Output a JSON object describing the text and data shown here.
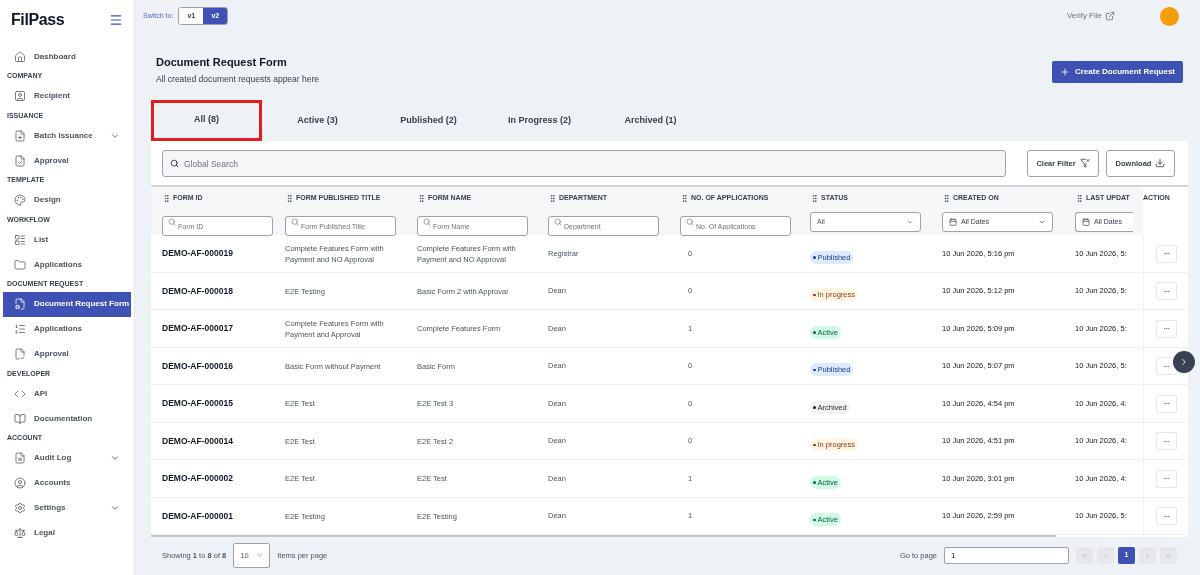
{
  "brand": {
    "logo": "FilPass"
  },
  "sidebar": {
    "sections": [
      {
        "items": [
          {
            "label": "Dashboard",
            "selected": false,
            "has_submenu": false
          }
        ]
      },
      {
        "heading": "COMPANY",
        "items": [
          {
            "label": "Recipient",
            "selected": false,
            "has_submenu": false
          }
        ]
      },
      {
        "heading": "ISSUANCE",
        "items": [
          {
            "label": "Batch Issuance",
            "selected": false,
            "has_submenu": true
          },
          {
            "label": "Approval",
            "selected": false,
            "has_submenu": false
          }
        ]
      },
      {
        "heading": "TEMPLATE",
        "items": [
          {
            "label": "Design",
            "selected": false,
            "has_submenu": false
          }
        ]
      },
      {
        "heading": "WORKFLOW",
        "items": [
          {
            "label": "List",
            "selected": false,
            "has_submenu": false
          },
          {
            "label": "Applications",
            "selected": false,
            "has_submenu": false
          }
        ]
      },
      {
        "heading": "DOCUMENT REQUEST",
        "items": [
          {
            "label": "Document Request Form",
            "selected": true,
            "has_submenu": false
          },
          {
            "label": "Applications",
            "selected": false,
            "has_submenu": false
          },
          {
            "label": "Approval",
            "selected": false,
            "has_submenu": false
          }
        ]
      },
      {
        "heading": "DEVELOPER",
        "items": [
          {
            "label": "API",
            "selected": false,
            "has_submenu": false
          },
          {
            "label": "Documentation",
            "selected": false,
            "has_submenu": false
          }
        ]
      },
      {
        "heading": "ACCOUNT",
        "items": [
          {
            "label": "Audit Log",
            "selected": false,
            "has_submenu": true
          },
          {
            "label": "Accounts",
            "selected": false,
            "has_submenu": false
          },
          {
            "label": "Settings",
            "selected": false,
            "has_submenu": true
          },
          {
            "label": "Legal",
            "selected": false,
            "has_submenu": false
          }
        ]
      }
    ]
  },
  "topbar": {
    "switch_label": "Switch to:",
    "versions": [
      {
        "label": "v1",
        "selected": false
      },
      {
        "label": "v2",
        "selected": true
      }
    ],
    "verify_link": "Verify File"
  },
  "page": {
    "title": "Document Request Form",
    "subtitle": "All created document requests appear here",
    "create_button": "Create Document Request"
  },
  "tabs": [
    {
      "label": "All (8)",
      "selected": true,
      "annotated": true
    },
    {
      "label": "Active (3)",
      "selected": false,
      "annotated": false
    },
    {
      "label": "Published (2)",
      "selected": false,
      "annotated": false
    },
    {
      "label": "In Progress (2)",
      "selected": false,
      "annotated": false
    },
    {
      "label": "Archived (1)",
      "selected": false,
      "annotated": false
    }
  ],
  "toolbar": {
    "search_placeholder": "Global Search",
    "clear_filter": "Clear Filter",
    "download": "Download"
  },
  "table": {
    "columns": [
      {
        "label": "FORM ID",
        "filter": {
          "kind": "search",
          "placeholder": "Form ID"
        }
      },
      {
        "label": "FORM PUBLISHED TITLE",
        "filter": {
          "kind": "search",
          "placeholder": "Form Published Title"
        }
      },
      {
        "label": "FORM NAME",
        "filter": {
          "kind": "search",
          "placeholder": "Form Name"
        }
      },
      {
        "label": "DEPARTMENT",
        "filter": {
          "kind": "search",
          "placeholder": "Department"
        }
      },
      {
        "label": "NO. OF APPLICATIONS",
        "filter": {
          "kind": "search",
          "placeholder": "No. Of Applications"
        }
      },
      {
        "label": "STATUS",
        "filter": {
          "kind": "select",
          "value": "All"
        }
      },
      {
        "label": "CREATED ON",
        "filter": {
          "kind": "date",
          "value": "All Dates"
        }
      },
      {
        "label": "LAST UPDAT",
        "filter": {
          "kind": "date",
          "value": "All Dates"
        }
      },
      {
        "label": "ACTION"
      }
    ],
    "rows": [
      {
        "form_id": "DEMO-AF-000019",
        "published_title": "Complete Features Form with Payment and NO Approval",
        "form_name": "Complete Features Form with Payment and NO Approval",
        "department": "Registrar",
        "applications": "0",
        "status": {
          "label": "Published",
          "kind": "published"
        },
        "created_on": "10 Jun 2026, 5:16 pm",
        "last_updated": "10 Jun 2026, 5:"
      },
      {
        "form_id": "DEMO-AF-000018",
        "published_title": "E2E Testing",
        "form_name": "Basic Form 2 with Approval",
        "department": "Dean",
        "applications": "0",
        "status": {
          "label": "In progress",
          "kind": "in_progress"
        },
        "created_on": "10 Jun 2026, 5:12 pm",
        "last_updated": "10 Jun 2026, 5:"
      },
      {
        "form_id": "DEMO-AF-000017",
        "published_title": "Complete Features Form with Payment and Approval",
        "form_name": "Complete Features Form",
        "department": "Dean",
        "applications": "1",
        "status": {
          "label": "Active",
          "kind": "active"
        },
        "created_on": "10 Jun 2026, 5:09 pm",
        "last_updated": "10 Jun 2026, 5:"
      },
      {
        "form_id": "DEMO-AF-000016",
        "published_title": "Basic Form without Payment",
        "form_name": "Basic Form",
        "department": "Dean",
        "applications": "0",
        "status": {
          "label": "Published",
          "kind": "published"
        },
        "created_on": "10 Jun 2026, 5:07 pm",
        "last_updated": "10 Jun 2026, 5:"
      },
      {
        "form_id": "DEMO-AF-000015",
        "published_title": "E2E Test",
        "form_name": "E2E Test 3",
        "department": "Dean",
        "applications": "0",
        "status": {
          "label": "Archived",
          "kind": "archived"
        },
        "created_on": "10 Jun 2026, 4:54 pm",
        "last_updated": "10 Jun 2026, 4:"
      },
      {
        "form_id": "DEMO-AF-000014",
        "published_title": "E2E Test",
        "form_name": "E2E Test 2",
        "department": "Dean",
        "applications": "0",
        "status": {
          "label": "In progress",
          "kind": "in_progress"
        },
        "created_on": "10 Jun 2026, 4:51 pm",
        "last_updated": "10 Jun 2026, 4:"
      },
      {
        "form_id": "DEMO-AF-000002",
        "published_title": "E2E Test",
        "form_name": "E2E Test",
        "department": "Dean",
        "applications": "1",
        "status": {
          "label": "Active",
          "kind": "active"
        },
        "created_on": "10 Jun 2026, 3:01 pm",
        "last_updated": "10 Jun 2026, 4:"
      },
      {
        "form_id": "DEMO-AF-000001",
        "published_title": "E2E Testing",
        "form_name": "E2E Testing",
        "department": "Dean",
        "applications": "1",
        "status": {
          "label": "Active",
          "kind": "active"
        },
        "created_on": "10 Jun 2026, 2:59 pm",
        "last_updated": "10 Jun 2026, 5:"
      }
    ]
  },
  "pagination": {
    "summary": "Showing **1** to **8** of **8**",
    "per_page": "10",
    "per_page_label": "Items per page",
    "goto_label": "Go to page",
    "goto_value": "1",
    "pages": [
      {
        "label": "1",
        "selected": true
      }
    ]
  }
}
